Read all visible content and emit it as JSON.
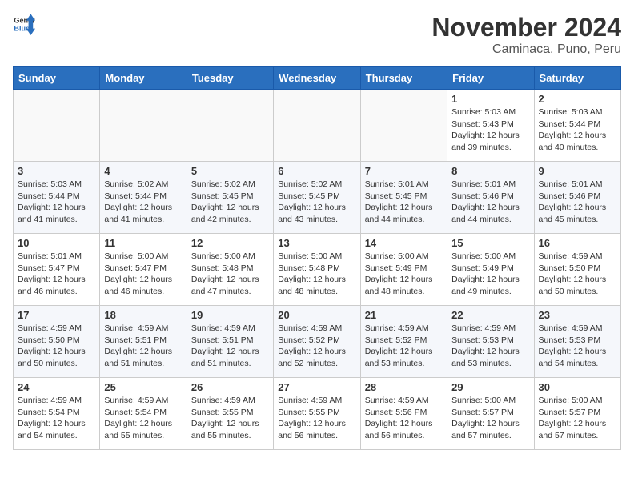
{
  "header": {
    "logo_general": "General",
    "logo_blue": "Blue",
    "month_year": "November 2024",
    "location": "Caminaca, Puno, Peru"
  },
  "days_of_week": [
    "Sunday",
    "Monday",
    "Tuesday",
    "Wednesday",
    "Thursday",
    "Friday",
    "Saturday"
  ],
  "weeks": [
    [
      {
        "day": "",
        "info": ""
      },
      {
        "day": "",
        "info": ""
      },
      {
        "day": "",
        "info": ""
      },
      {
        "day": "",
        "info": ""
      },
      {
        "day": "",
        "info": ""
      },
      {
        "day": "1",
        "info": "Sunrise: 5:03 AM\nSunset: 5:43 PM\nDaylight: 12 hours and 39 minutes."
      },
      {
        "day": "2",
        "info": "Sunrise: 5:03 AM\nSunset: 5:44 PM\nDaylight: 12 hours and 40 minutes."
      }
    ],
    [
      {
        "day": "3",
        "info": "Sunrise: 5:03 AM\nSunset: 5:44 PM\nDaylight: 12 hours and 41 minutes."
      },
      {
        "day": "4",
        "info": "Sunrise: 5:02 AM\nSunset: 5:44 PM\nDaylight: 12 hours and 41 minutes."
      },
      {
        "day": "5",
        "info": "Sunrise: 5:02 AM\nSunset: 5:45 PM\nDaylight: 12 hours and 42 minutes."
      },
      {
        "day": "6",
        "info": "Sunrise: 5:02 AM\nSunset: 5:45 PM\nDaylight: 12 hours and 43 minutes."
      },
      {
        "day": "7",
        "info": "Sunrise: 5:01 AM\nSunset: 5:45 PM\nDaylight: 12 hours and 44 minutes."
      },
      {
        "day": "8",
        "info": "Sunrise: 5:01 AM\nSunset: 5:46 PM\nDaylight: 12 hours and 44 minutes."
      },
      {
        "day": "9",
        "info": "Sunrise: 5:01 AM\nSunset: 5:46 PM\nDaylight: 12 hours and 45 minutes."
      }
    ],
    [
      {
        "day": "10",
        "info": "Sunrise: 5:01 AM\nSunset: 5:47 PM\nDaylight: 12 hours and 46 minutes."
      },
      {
        "day": "11",
        "info": "Sunrise: 5:00 AM\nSunset: 5:47 PM\nDaylight: 12 hours and 46 minutes."
      },
      {
        "day": "12",
        "info": "Sunrise: 5:00 AM\nSunset: 5:48 PM\nDaylight: 12 hours and 47 minutes."
      },
      {
        "day": "13",
        "info": "Sunrise: 5:00 AM\nSunset: 5:48 PM\nDaylight: 12 hours and 48 minutes."
      },
      {
        "day": "14",
        "info": "Sunrise: 5:00 AM\nSunset: 5:49 PM\nDaylight: 12 hours and 48 minutes."
      },
      {
        "day": "15",
        "info": "Sunrise: 5:00 AM\nSunset: 5:49 PM\nDaylight: 12 hours and 49 minutes."
      },
      {
        "day": "16",
        "info": "Sunrise: 4:59 AM\nSunset: 5:50 PM\nDaylight: 12 hours and 50 minutes."
      }
    ],
    [
      {
        "day": "17",
        "info": "Sunrise: 4:59 AM\nSunset: 5:50 PM\nDaylight: 12 hours and 50 minutes."
      },
      {
        "day": "18",
        "info": "Sunrise: 4:59 AM\nSunset: 5:51 PM\nDaylight: 12 hours and 51 minutes."
      },
      {
        "day": "19",
        "info": "Sunrise: 4:59 AM\nSunset: 5:51 PM\nDaylight: 12 hours and 51 minutes."
      },
      {
        "day": "20",
        "info": "Sunrise: 4:59 AM\nSunset: 5:52 PM\nDaylight: 12 hours and 52 minutes."
      },
      {
        "day": "21",
        "info": "Sunrise: 4:59 AM\nSunset: 5:52 PM\nDaylight: 12 hours and 53 minutes."
      },
      {
        "day": "22",
        "info": "Sunrise: 4:59 AM\nSunset: 5:53 PM\nDaylight: 12 hours and 53 minutes."
      },
      {
        "day": "23",
        "info": "Sunrise: 4:59 AM\nSunset: 5:53 PM\nDaylight: 12 hours and 54 minutes."
      }
    ],
    [
      {
        "day": "24",
        "info": "Sunrise: 4:59 AM\nSunset: 5:54 PM\nDaylight: 12 hours and 54 minutes."
      },
      {
        "day": "25",
        "info": "Sunrise: 4:59 AM\nSunset: 5:54 PM\nDaylight: 12 hours and 55 minutes."
      },
      {
        "day": "26",
        "info": "Sunrise: 4:59 AM\nSunset: 5:55 PM\nDaylight: 12 hours and 55 minutes."
      },
      {
        "day": "27",
        "info": "Sunrise: 4:59 AM\nSunset: 5:55 PM\nDaylight: 12 hours and 56 minutes."
      },
      {
        "day": "28",
        "info": "Sunrise: 4:59 AM\nSunset: 5:56 PM\nDaylight: 12 hours and 56 minutes."
      },
      {
        "day": "29",
        "info": "Sunrise: 5:00 AM\nSunset: 5:57 PM\nDaylight: 12 hours and 57 minutes."
      },
      {
        "day": "30",
        "info": "Sunrise: 5:00 AM\nSunset: 5:57 PM\nDaylight: 12 hours and 57 minutes."
      }
    ]
  ]
}
